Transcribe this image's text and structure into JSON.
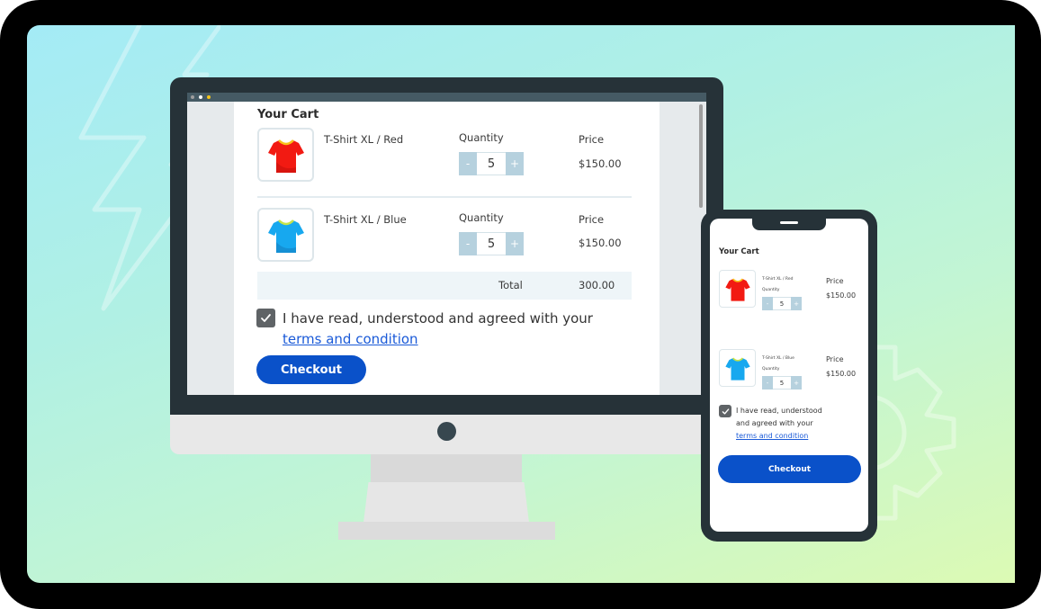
{
  "colors": {
    "primary": "#0a51c9",
    "link": "#1a5ad8",
    "stepper": "#b6d1de",
    "bezel": "#263238"
  },
  "desktop": {
    "browser_dots": [
      "#9e9e9e",
      "#ffffff",
      "#f5c518"
    ],
    "cart": {
      "title": "Your Cart",
      "quantity_label": "Quantity",
      "price_label": "Price",
      "items": [
        {
          "name": "T-Shirt XL / Red",
          "color": "red",
          "quantity": "5",
          "price": "$150.00",
          "decrement": "-",
          "increment": "+"
        },
        {
          "name": "T-Shirt XL / Blue",
          "color": "blue",
          "quantity": "5",
          "price": "$150.00",
          "decrement": "-",
          "increment": "+"
        }
      ],
      "total_label": "Total",
      "total_value": "300.00",
      "agree_text": "I have read, understood and agreed with your",
      "terms_link": "terms and condition",
      "agree_checked": true,
      "checkout_label": "Checkout"
    }
  },
  "mobile": {
    "cart": {
      "title": "Your Cart",
      "quantity_label": "Quantity",
      "price_label": "Price",
      "items": [
        {
          "name": "T-Shirt XL / Red",
          "color": "red",
          "quantity": "5",
          "price": "$150.00",
          "decrement": "-",
          "increment": "+"
        },
        {
          "name": "T-Shirt XL / Blue",
          "color": "blue",
          "quantity": "5",
          "price": "$150.00",
          "decrement": "-",
          "increment": "+"
        }
      ],
      "agree_text_line1": "I have read, understood",
      "agree_text_line2": "and agreed with your",
      "terms_link": "terms and condition",
      "agree_checked": true,
      "checkout_label": "Checkout"
    }
  },
  "background_icons": [
    "lightning-bolt-icon",
    "gear-icon"
  ]
}
